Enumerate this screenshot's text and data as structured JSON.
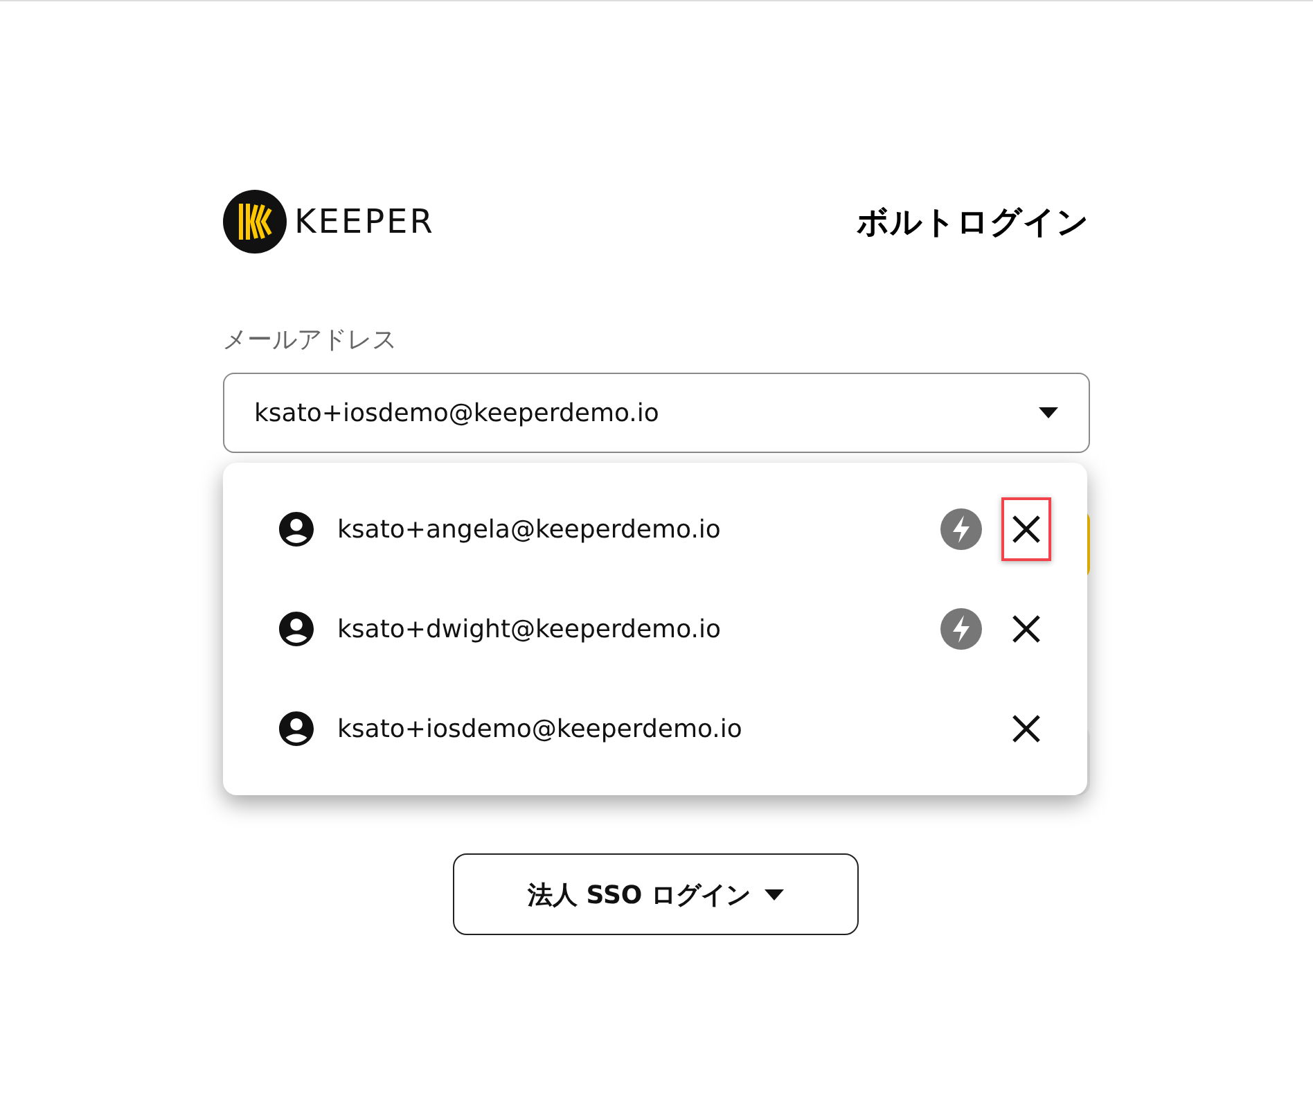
{
  "header": {
    "brand": "KEEPER",
    "title": "ボルトログイン"
  },
  "email": {
    "label": "メールアドレス",
    "value": "ksato+iosdemo@keeperdemo.io"
  },
  "account_menu": {
    "expanded": true,
    "accounts": [
      {
        "email": "ksato+angela@keeperdemo.io",
        "fast_login": true,
        "highlighted": true
      },
      {
        "email": "ksato+dwight@keeperdemo.io",
        "fast_login": true,
        "highlighted": false
      },
      {
        "email": "ksato+iosdemo@keeperdemo.io",
        "fast_login": false,
        "highlighted": false
      }
    ]
  },
  "sso_button": {
    "label": "法人 SSO ログイン"
  }
}
